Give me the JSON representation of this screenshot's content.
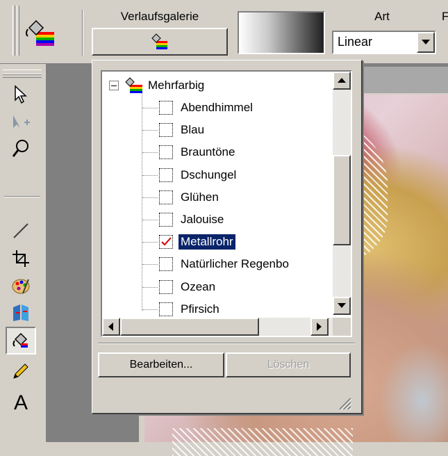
{
  "toolbar": {
    "gallery_label": "Verlaufsgalerie",
    "type_label": "Art",
    "type_value": "Linear",
    "cut_label": "F"
  },
  "tree": {
    "root_label": "Mehrfarbig",
    "items": [
      {
        "label": "Abendhimmel",
        "checked": false
      },
      {
        "label": "Blau",
        "checked": false
      },
      {
        "label": "Brauntöne",
        "checked": false
      },
      {
        "label": "Dschungel",
        "checked": false
      },
      {
        "label": "Glühen",
        "checked": false
      },
      {
        "label": "Jalouise",
        "checked": false
      },
      {
        "label": "Metallrohr",
        "checked": true
      },
      {
        "label": "Natürlicher Regenbo",
        "checked": false
      },
      {
        "label": "Ozean",
        "checked": false
      },
      {
        "label": "Pfirsich",
        "checked": false
      }
    ]
  },
  "buttons": {
    "edit": "Bearbeiten...",
    "delete": "Löschen"
  },
  "tools": [
    "arrow-icon",
    "move-icon",
    "magnifier-icon",
    "line-icon",
    "crop-icon",
    "palette-icon",
    "book-icon",
    "paint-bucket-icon",
    "pencil-icon",
    "text-icon"
  ],
  "tool_text": "A",
  "colors": {
    "selection": "#0a246a",
    "face": "#d4d0c8"
  }
}
